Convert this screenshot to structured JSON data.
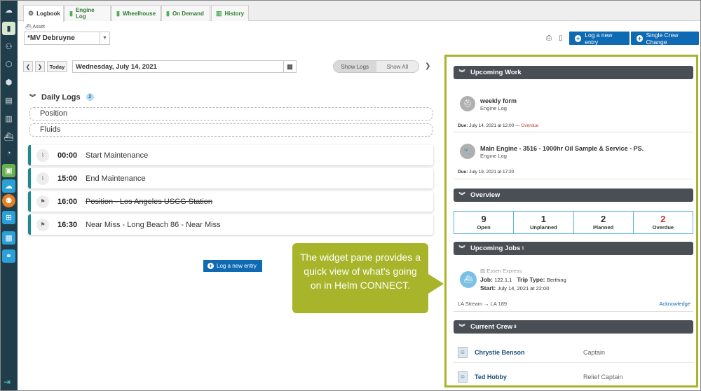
{
  "sidebar": {
    "items": [
      {
        "icon": "cloud-icon"
      },
      {
        "icon": "book-icon"
      },
      {
        "icon": "users-icon"
      },
      {
        "icon": "box-icon"
      },
      {
        "icon": "package-icon"
      },
      {
        "icon": "archive-icon"
      },
      {
        "icon": "book-open-icon"
      },
      {
        "icon": "ship-icon"
      },
      {
        "icon": "gauge-icon"
      },
      {
        "icon": "clipboard-icon"
      },
      {
        "icon": "cloud-blue-icon"
      },
      {
        "icon": "people-icon"
      },
      {
        "icon": "apps-icon"
      },
      {
        "icon": "document-icon"
      },
      {
        "icon": "link-icon"
      }
    ]
  },
  "tabs": [
    {
      "label": "Logbook",
      "icon": "gear-icon",
      "active": true
    },
    {
      "label": "Engine Log",
      "icon": "book-icon"
    },
    {
      "label": "Wheelhouse",
      "icon": "book-icon"
    },
    {
      "label": "On Demand",
      "icon": "book-icon"
    },
    {
      "label": "History",
      "icon": "history-icon"
    }
  ],
  "asset": {
    "label": "Asset",
    "value": "*MV Debruyne"
  },
  "toolbar": {
    "log_new_entry": "Log a new entry",
    "single_crew_change": "Single Crew Change"
  },
  "datebar": {
    "today": "Today",
    "date": "Wednesday, July 14, 2021",
    "show_logs": "Show Logs",
    "show_all": "Show All"
  },
  "daily_logs": {
    "title": "Daily Logs",
    "count": "2",
    "groups": [
      "Position",
      "Fluids"
    ],
    "entries": [
      {
        "time": "00:00",
        "desc": "Start Maintenance",
        "strike": false,
        "icon": "activity-icon"
      },
      {
        "time": "15:00",
        "desc": "End Maintenance",
        "strike": false,
        "icon": "activity-icon"
      },
      {
        "time": "16:00",
        "desc": "Position - Los Angeles USCG Station",
        "strike": true,
        "icon": "flag-icon"
      },
      {
        "time": "16:30",
        "desc": "Near Miss - Long Beach 86 - Near Miss",
        "strike": false,
        "icon": "flag-icon"
      }
    ],
    "log_new_entry": "Log a new entry"
  },
  "callout": {
    "text": "The widget pane provides a quick view of what's going on in Helm CONNECT."
  },
  "widgets": {
    "upcoming_work": {
      "title": "Upcoming Work",
      "items": [
        {
          "title": "weekly form",
          "sub": "Engine Log",
          "due_label": "Due:",
          "due": "July 14, 2021 at 12:00",
          "sep": " — ",
          "status": "Overdue"
        },
        {
          "title": "Main Engine - 3516 - 1000hr Oil Sample & Service - PS.",
          "sub": "Engine Log",
          "due_label": "Due:",
          "due": "July 19, 2021 at 17:20",
          "sep": "",
          "status": ""
        }
      ]
    },
    "overview": {
      "title": "Overview",
      "cells": [
        {
          "num": "9",
          "label": "Open",
          "red": false
        },
        {
          "num": "1",
          "label": "Unplanned",
          "red": false
        },
        {
          "num": "2",
          "label": "Planned",
          "red": false
        },
        {
          "num": "2",
          "label": "Overdue",
          "red": true
        }
      ]
    },
    "upcoming_jobs": {
      "title": "Upcoming Jobs",
      "count": "1",
      "company": "Essen Express",
      "job_label": "Job:",
      "job": "122.1.1",
      "trip_label": "Trip Type:",
      "trip": "Berthing",
      "start_label": "Start:",
      "start": "July 14, 2021 at 22:00",
      "route_from": "LA Stream",
      "route_arrow": "→",
      "route_to": "LA 189",
      "acknowledge": "Acknowledge"
    },
    "current_crew": {
      "title": "Current Crew",
      "count": "8",
      "members": [
        {
          "name": "Chrystie  Benson",
          "role": "Captain"
        },
        {
          "name": "Ted  Hobby",
          "role": "Relief Captain"
        }
      ]
    }
  },
  "colors": {
    "sidebar": "#1f3d4a",
    "primary": "#0e6ab3",
    "accent_green": "#a8b52a",
    "entry_border": "#1a8a8a",
    "overdue": "#c0392b"
  }
}
